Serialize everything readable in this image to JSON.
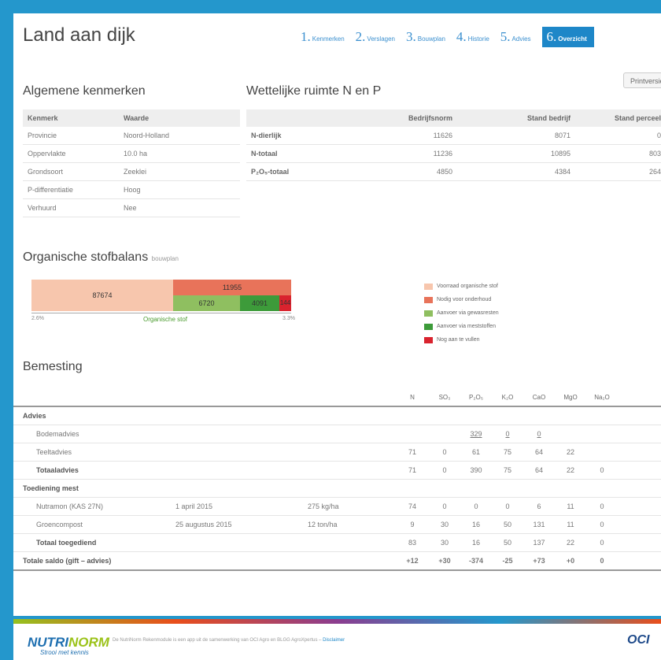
{
  "header": {
    "title": "Land aan dijk",
    "steps": [
      {
        "num": "1.",
        "label": "Kenmerken"
      },
      {
        "num": "2.",
        "label": "Verslagen"
      },
      {
        "num": "3.",
        "label": "Bouwplan"
      },
      {
        "num": "4.",
        "label": "Historie"
      },
      {
        "num": "5.",
        "label": "Advies"
      },
      {
        "num": "6.",
        "label": "Overzicht"
      }
    ]
  },
  "algemeen": {
    "title": "Algemene kenmerken",
    "headers": [
      "Kenmerk",
      "Waarde"
    ],
    "rows": [
      [
        "Provincie",
        "Noord-Holland"
      ],
      [
        "Oppervlakte",
        "10.0 ha"
      ],
      [
        "Grondsoort",
        "Zeeklei"
      ],
      [
        "P-differentiatie",
        "Hoog"
      ],
      [
        "Verhuurd",
        "Nee"
      ]
    ]
  },
  "wettelijk": {
    "title": "Wettelijke ruimte N en P",
    "print_label": "Printversie",
    "headers": [
      "",
      "Bedrijfsnorm",
      "Stand bedrijf",
      "Stand perceel"
    ],
    "rows": [
      [
        "N-dierlijk",
        "11626",
        "8071",
        "0"
      ],
      [
        "N-totaal",
        "11236",
        "10895",
        "803"
      ],
      [
        "P₂O₅-totaal",
        "4850",
        "4384",
        "264"
      ]
    ]
  },
  "organisch": {
    "title": "Organische stofbalans",
    "subtitle": "bouwplan",
    "legend": [
      {
        "label": "Voorraad organische stof",
        "color": "#f7c6ad"
      },
      {
        "label": "Nodig voor onderhoud",
        "color": "#e8735a"
      },
      {
        "label": "Aanvoer via gewasresten",
        "color": "#8fbf60"
      },
      {
        "label": "Aanvoer via meststoffen",
        "color": "#3d9b3a"
      },
      {
        "label": "Nog aan te vullen",
        "color": "#d9232e"
      }
    ],
    "voorraad": "87674",
    "onderhoud": "11955",
    "gewasresten": "6720",
    "meststoffen": "4091",
    "aanvullen": "144",
    "axis_left": "2.6%",
    "axis_center": "Organische stof",
    "axis_right": "3.3%"
  },
  "bemesting": {
    "title": "Bemesting",
    "columns": [
      "N",
      "SO₃",
      "P₂O₅",
      "K₂O",
      "CaO",
      "MgO",
      "Na₂O"
    ],
    "advies_label": "Advies",
    "bodemadvies": {
      "label": "Bodemadvies",
      "vals": [
        "",
        "",
        "329",
        "0",
        "0",
        "",
        ""
      ]
    },
    "teeltadvies": {
      "label": "Teeltadvies",
      "vals": [
        "71",
        "0",
        "61",
        "75",
        "64",
        "22",
        ""
      ]
    },
    "totaaladvies": {
      "label": "Totaaladvies",
      "vals": [
        "71",
        "0",
        "390",
        "75",
        "64",
        "22",
        "0"
      ]
    },
    "toediening_label": "Toediening mest",
    "mest": [
      {
        "name": "Nutramon (KAS 27N)",
        "date": "1 april 2015",
        "amount": "275 kg/ha",
        "vals": [
          "74",
          "0",
          "0",
          "0",
          "6",
          "11",
          "0"
        ]
      },
      {
        "name": "Groencompost",
        "date": "25 augustus 2015",
        "amount": "12 ton/ha",
        "vals": [
          "9",
          "30",
          "16",
          "50",
          "131",
          "11",
          "0"
        ]
      }
    ],
    "totaal_toegediend": {
      "label": "Totaal toegediend",
      "vals": [
        "83",
        "30",
        "16",
        "50",
        "137",
        "22",
        "0"
      ]
    },
    "saldo": {
      "label": "Totale saldo (gift – advies)",
      "vals": [
        "+12",
        "+30",
        "-374",
        "-25",
        "+73",
        "+0",
        "0"
      ]
    }
  },
  "footer": {
    "logo_a": "NUTRI",
    "logo_b": "NORM",
    "slogan": "Strooi met kennis",
    "text": "De NutriNorm Rekenmodule is een app uit de samenwerking van OCI Agro en BLGG AgroXpertus –",
    "disclaimer": "Disclaimer",
    "partner": "OCI"
  }
}
